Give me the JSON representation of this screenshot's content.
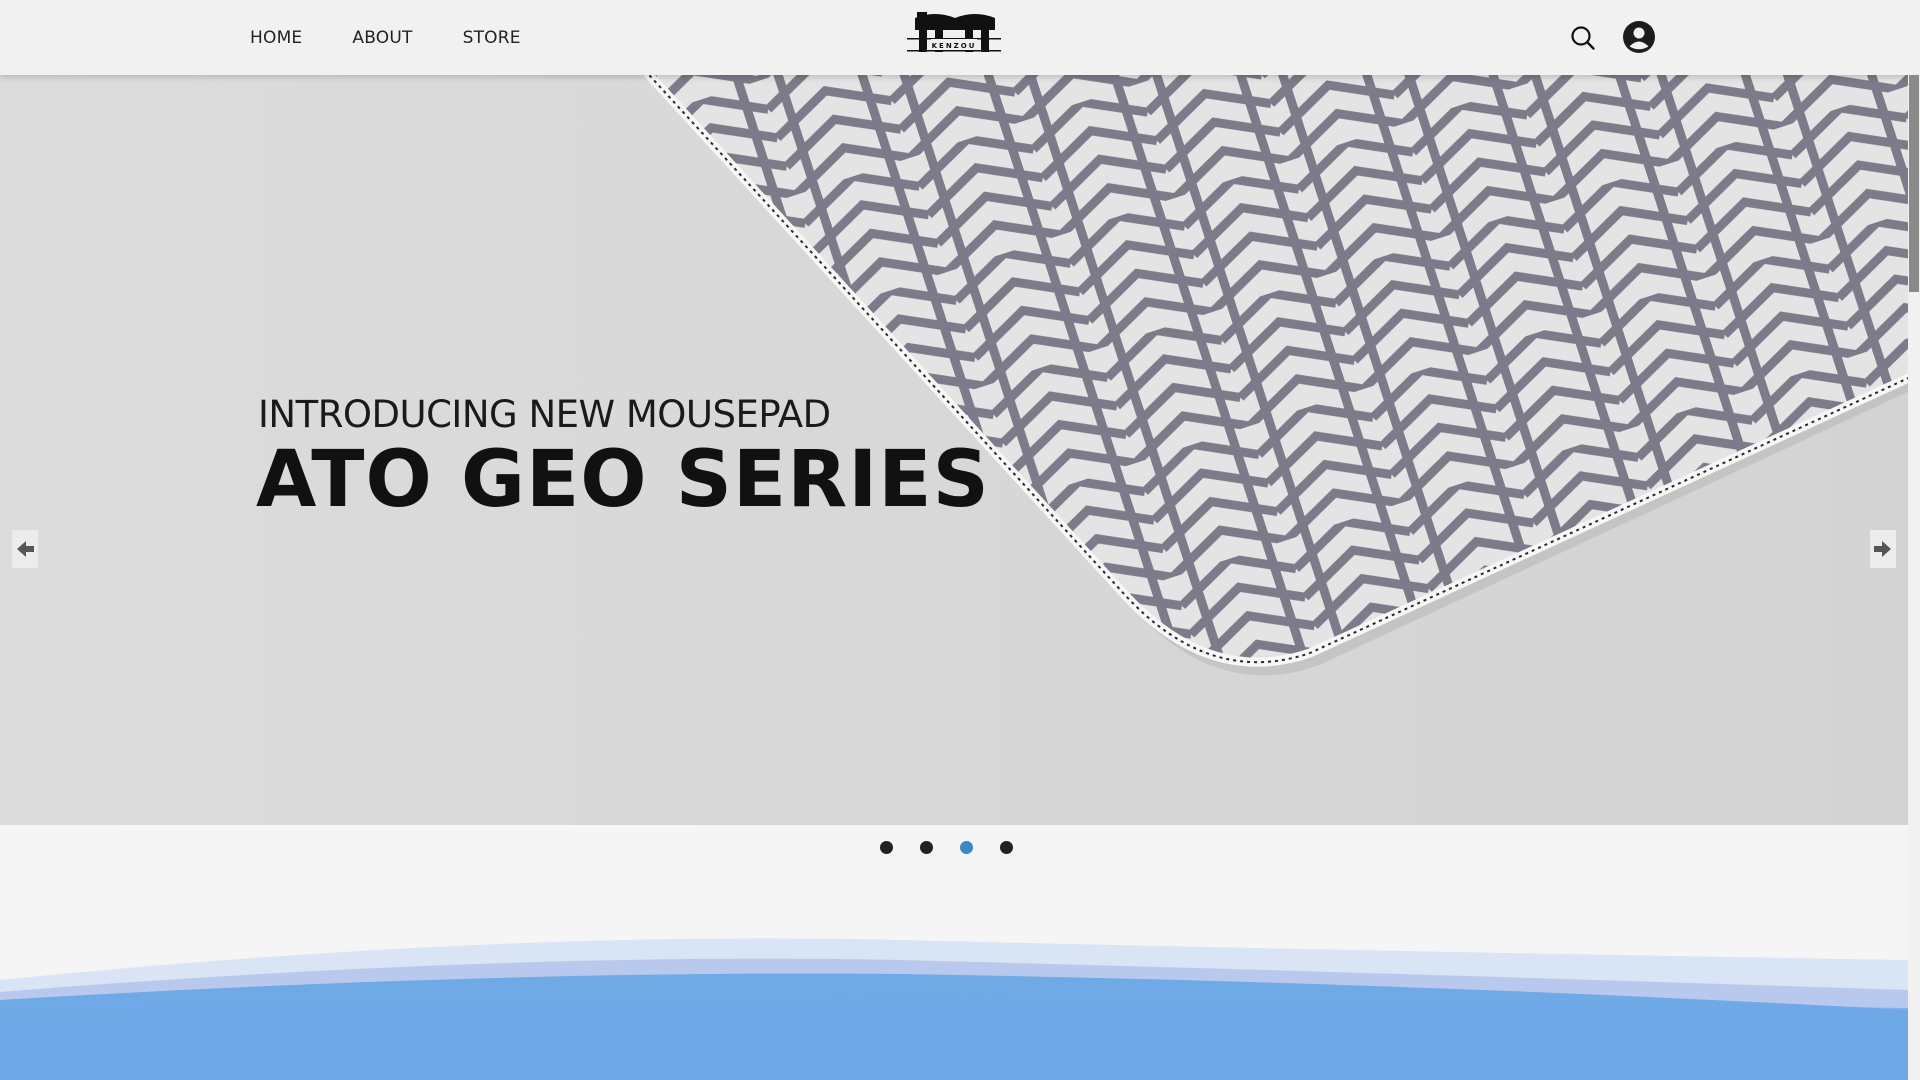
{
  "nav": {
    "items": [
      {
        "label": "HOME"
      },
      {
        "label": "ABOUT"
      },
      {
        "label": "STORE"
      }
    ]
  },
  "logo": {
    "text": "KENZOU",
    "icon": "kenzou-logo"
  },
  "header_icons": {
    "search": "search-icon",
    "account": "user-avatar-icon"
  },
  "hero": {
    "eyebrow": "INTRODUCING NEW MOUSEPAD",
    "title": "ATO GEO SERIES",
    "prev_icon": "arrow-left-icon",
    "next_icon": "arrow-right-icon"
  },
  "carousel": {
    "slide_count": 4,
    "active_index": 2
  },
  "colors": {
    "header_bg": "#f1f1f1",
    "hero_bg": "#d6d6d6",
    "stripe": "#7b7b89",
    "dot_active": "#3b87c8",
    "dot_inactive": "#222222",
    "wave": "#6fa9e6"
  }
}
